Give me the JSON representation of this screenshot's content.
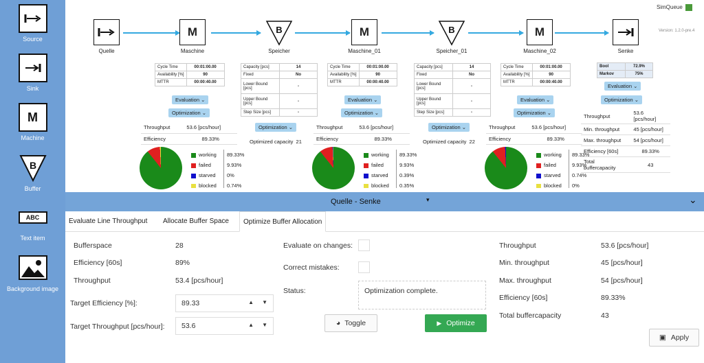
{
  "palette": {
    "source": "Source",
    "sink": "Sink",
    "machine": "Machine",
    "buffer": "Buffer",
    "text": "Text item",
    "image": "Background image",
    "text_glyph": "ABC"
  },
  "brand": {
    "name": "SimQueue",
    "version": "Version: 1.2.0-pre.4"
  },
  "nodes": {
    "quelle": "Quelle",
    "m1": "Maschine",
    "b1": "Speicher",
    "m2": "Maschine_01",
    "b2": "Speicher_01",
    "m3": "Maschine_02",
    "senke": "Senke"
  },
  "glyph": {
    "machine": "M",
    "buffer": "B"
  },
  "machine_params": {
    "cycle_time_label": "Cycle Time",
    "cycle_time": "00:01:00.00",
    "availability_label": "Availability [%]",
    "availability": "90",
    "mttr_label": "MTTR",
    "mttr": "00:00:40.00"
  },
  "buffer_params": {
    "capacity_label": "Capacity [pcs]",
    "capacity": "14",
    "fixed_label": "Fixed",
    "fixed": "No",
    "lower_label": "Lower Bound [pcs]",
    "lower": "-",
    "upper_label": "Upper Bound [pcs]",
    "upper": "-",
    "step_label": "Step Size [pcs]",
    "step": "-"
  },
  "buttons": {
    "evaluation": "Evaluation",
    "optimization": "Optimization"
  },
  "machine_stats": [
    {
      "throughput_label": "Throughput",
      "throughput": "53.6 [pcs/hour]",
      "efficiency_label": "Efficiency",
      "efficiency": "89.33%"
    },
    {
      "throughput_label": "Throughput",
      "throughput": "53.6 [pcs/hour]",
      "efficiency_label": "Efficiency",
      "efficiency": "89.33%"
    },
    {
      "throughput_label": "Throughput",
      "throughput": "53.6 [pcs/hour]",
      "efficiency_label": "Efficiency",
      "efficiency": "89.33%"
    }
  ],
  "optimized_capacity": [
    {
      "label": "Optimized capacity",
      "value": "21"
    },
    {
      "label": "Optimized capacity",
      "value": "22"
    }
  ],
  "pies": [
    {
      "working_label": "working",
      "working": "89.33%",
      "failed_label": "failed",
      "failed": "9.93%",
      "starved_label": "starved",
      "starved": "0%",
      "blocked_label": "blocked",
      "blocked": "0.74%",
      "fractions": {
        "working": 0.8933,
        "failed": 0.0993,
        "starved": 0.0,
        "blocked": 0.0074
      }
    },
    {
      "working_label": "working",
      "working": "89.33%",
      "failed_label": "failed",
      "failed": "9.93%",
      "starved_label": "starved",
      "starved": "0.39%",
      "blocked_label": "blocked",
      "blocked": "0.35%",
      "fractions": {
        "working": 0.8933,
        "failed": 0.0993,
        "starved": 0.0039,
        "blocked": 0.0035
      }
    },
    {
      "working_label": "working",
      "working": "89.33%",
      "failed_label": "failed",
      "failed": "9.93%",
      "starved_label": "starved",
      "starved": "0.74%",
      "blocked_label": "blocked",
      "blocked": "0%",
      "fractions": {
        "working": 0.8933,
        "failed": 0.0993,
        "starved": 0.0074,
        "blocked": 0.0
      }
    }
  ],
  "pie_colors": {
    "working": "#1a8a1a",
    "failed": "#e02020",
    "starved": "#1010cc",
    "blocked": "#e8e040"
  },
  "senke": {
    "bool_label": "Bool",
    "bool": "72.9%",
    "markov_label": "Markov",
    "markov": "75%",
    "throughput_label": "Throughput",
    "throughput": "53.6 [pcs/hour]",
    "min_label": "Min. throughput",
    "min": "45 [pcs/hour]",
    "max_label": "Max. throughput",
    "max": "54 [pcs/hour]",
    "eff_label": "Efficiency [60s]",
    "eff": "89.33%",
    "total_label": "Total buffercapacity",
    "total": "43"
  },
  "divider": {
    "title": "Quelle - Senke"
  },
  "tabs": [
    "Evaluate Line Throughput",
    "Allocate Buffer Space",
    "Optimize Buffer Allocation"
  ],
  "panel": {
    "bufferspace_label": "Bufferspace",
    "bufferspace": "28",
    "efficiency_label": "Efficiency [60s]",
    "efficiency": "89%",
    "throughput_label": "Throughput",
    "throughput": "53.4 [pcs/hour]",
    "target_eff_label": "Target Efficiency [%]:",
    "target_eff": "89.33",
    "target_tp_label": "Target Throughput [pcs/hour]:",
    "target_tp": "53.6",
    "evaluate_label": "Evaluate on changes:",
    "correct_label": "Correct mistakes:",
    "status_label": "Status:",
    "status": "Optimization complete.",
    "toggle": "Toggle",
    "optimize": "Optimize",
    "apply": "Apply",
    "r_throughput_label": "Throughput",
    "r_throughput": "53.6 [pcs/hour]",
    "r_min_label": "Min. throughput",
    "r_min": "45 [pcs/hour]",
    "r_max_label": "Max. throughput",
    "r_max": "54 [pcs/hour]",
    "r_eff_label": "Efficiency [60s]",
    "r_eff": "89.33%",
    "r_total_label": "Total buffercapacity",
    "r_total": "43"
  },
  "colors": {
    "palette_bg": "#6f9fd6",
    "accent_arrow": "#34a9e0",
    "optimize_green": "#34a853",
    "dropdown_bg": "#a9d3ef"
  }
}
